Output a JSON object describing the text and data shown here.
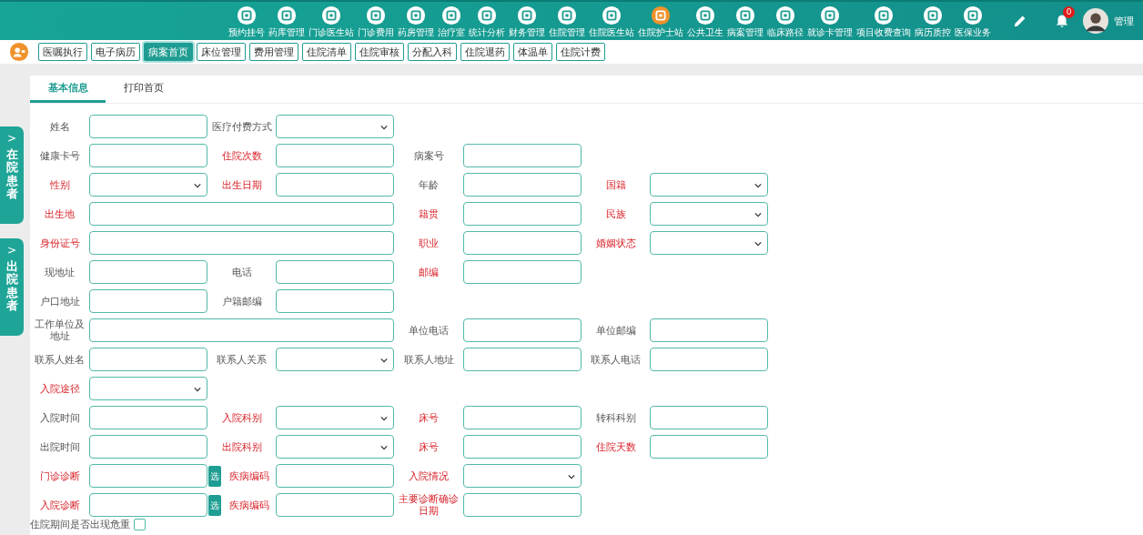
{
  "nav": {
    "modules": [
      {
        "label": "预约挂号",
        "selected": false
      },
      {
        "label": "药库管理",
        "selected": false
      },
      {
        "label": "门诊医生站",
        "selected": false
      },
      {
        "label": "门诊费用",
        "selected": false
      },
      {
        "label": "药房管理",
        "selected": false
      },
      {
        "label": "治疗室",
        "selected": false
      },
      {
        "label": "统计分析",
        "selected": false
      },
      {
        "label": "财务管理",
        "selected": false
      },
      {
        "label": "住院管理",
        "selected": false
      },
      {
        "label": "住院医生站",
        "selected": false
      },
      {
        "label": "住院护士站",
        "selected": true
      },
      {
        "label": "公共卫生",
        "selected": false
      },
      {
        "label": "病案管理",
        "selected": false
      },
      {
        "label": "临床路径",
        "selected": false
      },
      {
        "label": "就诊卡管理",
        "selected": false
      },
      {
        "label": "项目收费查询",
        "selected": false
      },
      {
        "label": "病历质控",
        "selected": false
      },
      {
        "label": "医保业务",
        "selected": false
      }
    ],
    "notifications": "0",
    "user": "管理"
  },
  "tabs": [
    {
      "label": "医嘱执行",
      "selected": false
    },
    {
      "label": "电子病历",
      "selected": false
    },
    {
      "label": "病案首页",
      "selected": true
    },
    {
      "label": "床位管理",
      "selected": false
    },
    {
      "label": "费用管理",
      "selected": false
    },
    {
      "label": "住院清单",
      "selected": false
    },
    {
      "label": "住院审核",
      "selected": false
    },
    {
      "label": "分配入科",
      "selected": false
    },
    {
      "label": "住院退药",
      "selected": false
    },
    {
      "label": "体温单",
      "selected": false
    },
    {
      "label": "住院计费",
      "selected": false
    }
  ],
  "side_tabs": [
    {
      "arrow": ">",
      "label": "在院患者"
    },
    {
      "arrow": ">",
      "label": "出院患者"
    }
  ],
  "subtabs": [
    {
      "label": "基本信息",
      "selected": true
    },
    {
      "label": "打印首页",
      "selected": false
    }
  ],
  "form_rows": [
    [
      {
        "label": "姓名",
        "required": false,
        "kind": "text",
        "wide": false
      },
      {
        "label": "医疗付费方式",
        "required": false,
        "kind": "select",
        "wide": false
      }
    ],
    [
      {
        "label": "健康卡号",
        "required": false,
        "kind": "text",
        "wide": false
      },
      {
        "label": "住院次数",
        "required": true,
        "kind": "text",
        "wide": false
      },
      {
        "label": "病案号",
        "required": false,
        "kind": "text",
        "wide": false
      }
    ],
    [
      {
        "label": "性别",
        "required": true,
        "kind": "select",
        "wide": false
      },
      {
        "label": "出生日期",
        "required": true,
        "kind": "text",
        "wide": false
      },
      {
        "label": "年龄",
        "required": false,
        "kind": "text",
        "wide": false
      },
      {
        "label": "国籍",
        "required": true,
        "kind": "select",
        "wide": false
      }
    ],
    [
      {
        "label": "出生地",
        "required": true,
        "kind": "text",
        "wide": true
      },
      {
        "label": "籍贯",
        "required": true,
        "kind": "text",
        "wide": false
      },
      {
        "label": "民族",
        "required": true,
        "kind": "select",
        "wide": false
      }
    ],
    [
      {
        "label": "身份证号",
        "required": true,
        "kind": "text",
        "wide": true
      },
      {
        "label": "职业",
        "required": true,
        "kind": "text",
        "wide": false
      },
      {
        "label": "婚姻状态",
        "required": true,
        "kind": "select",
        "wide": false
      }
    ],
    [
      {
        "label": "现地址",
        "required": false,
        "kind": "text",
        "wide": false
      },
      {
        "label": "电话",
        "required": false,
        "kind": "text",
        "wide": false
      },
      {
        "label": "邮编",
        "required": true,
        "kind": "text",
        "wide": false
      }
    ],
    [
      {
        "label": "户口地址",
        "required": false,
        "kind": "text",
        "wide": false
      },
      {
        "label": "户籍邮编",
        "required": false,
        "kind": "text",
        "wide": false
      }
    ],
    [
      {
        "label": "工作单位及地址",
        "required": false,
        "kind": "text",
        "wide": true
      },
      {
        "label": "单位电话",
        "required": false,
        "kind": "text",
        "wide": false
      },
      {
        "label": "单位邮编",
        "required": false,
        "kind": "text",
        "wide": false
      }
    ],
    [
      {
        "label": "联系人姓名",
        "required": false,
        "kind": "text",
        "wide": false
      },
      {
        "label": "联系人关系",
        "required": false,
        "kind": "select",
        "wide": false
      },
      {
        "label": "联系人地址",
        "required": false,
        "kind": "text",
        "wide": false
      },
      {
        "label": "联系人电话",
        "required": false,
        "kind": "text",
        "wide": false
      }
    ],
    [
      {
        "label": "入院途径",
        "required": true,
        "kind": "select",
        "wide": false
      }
    ],
    [
      {
        "label": "入院时间",
        "required": false,
        "kind": "text",
        "wide": false
      },
      {
        "label": "入院科别",
        "required": true,
        "kind": "select",
        "wide": false
      },
      {
        "label": "床号",
        "required": true,
        "kind": "text",
        "wide": false
      },
      {
        "label": "转科科别",
        "required": false,
        "kind": "text",
        "wide": false
      }
    ],
    [
      {
        "label": "出院时间",
        "required": false,
        "kind": "text",
        "wide": false
      },
      {
        "label": "出院科别",
        "required": true,
        "kind": "select",
        "wide": false
      },
      {
        "label": "床号",
        "required": true,
        "kind": "text",
        "wide": false
      },
      {
        "label": "住院天数",
        "required": true,
        "kind": "text",
        "wide": false
      }
    ],
    [
      {
        "label": "门诊诊断",
        "required": true,
        "kind": "pick",
        "wide": false,
        "button": "选"
      },
      {
        "label": "疾病编码",
        "required": true,
        "kind": "text",
        "wide": false
      },
      {
        "label": "入院情况",
        "required": true,
        "kind": "select",
        "wide": false
      }
    ],
    [
      {
        "label": "入院诊断",
        "required": true,
        "kind": "pick",
        "wide": false,
        "button": "选"
      },
      {
        "label": "疾病编码",
        "required": true,
        "kind": "text",
        "wide": false
      },
      {
        "label": "主要诊断确诊日期",
        "required": true,
        "kind": "text",
        "wide": false
      }
    ]
  ],
  "critical": {
    "label": "住院期间是否出现危重",
    "checked": false
  }
}
